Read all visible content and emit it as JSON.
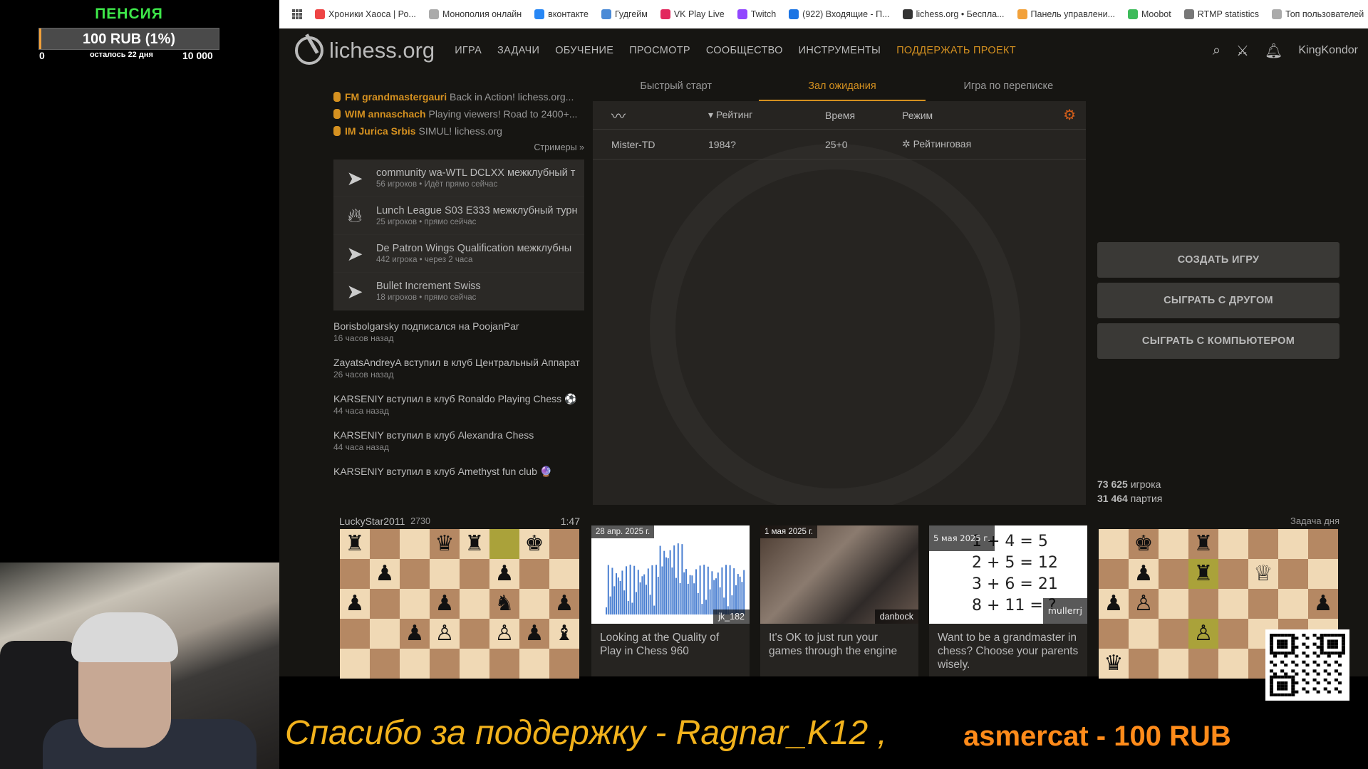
{
  "overlay": {
    "pension_title": "ПЕНСИЯ",
    "goal_text": "100 RUB (1%)",
    "goal_min": "0",
    "goal_remaining": "осталось 22 дня",
    "goal_max": "10 000",
    "goal_progress": 0.01,
    "accent_color": "#3ee84a"
  },
  "bookmarks": [
    {
      "label": "Хроники Хаоса | Ро...",
      "icon": "chaos-icon",
      "color": "#e44"
    },
    {
      "label": "Монополия онлайн",
      "icon": "monopoly-icon",
      "color": "#aaa"
    },
    {
      "label": "вконтакте",
      "icon": "vk-icon",
      "color": "#2787f5"
    },
    {
      "label": "Гудгейм",
      "icon": "goodgame-icon",
      "color": "#4a8ad6"
    },
    {
      "label": "VK Play Live",
      "icon": "vkplay-icon",
      "color": "#e2275d"
    },
    {
      "label": "Twitch",
      "icon": "twitch-icon",
      "color": "#9146ff"
    },
    {
      "label": "(922) Входящие - П...",
      "icon": "mail-icon",
      "color": "#1b74e4"
    },
    {
      "label": "lichess.org • Беспла...",
      "icon": "lichess-icon",
      "color": "#333"
    },
    {
      "label": "Панель управлени...",
      "icon": "panel-icon",
      "color": "#f2a13a"
    },
    {
      "label": "Moobot",
      "icon": "moobot-icon",
      "color": "#3dbb5a"
    },
    {
      "label": "RTMP statistics",
      "icon": "rtmp-icon",
      "color": "#777"
    },
    {
      "label": "Топ пользователей",
      "icon": "top-icon",
      "color": "#aaa"
    }
  ],
  "nav": {
    "logo": "lichess.org",
    "items": [
      "ИГРА",
      "ЗАДАЧИ",
      "ОБУЧЕНИЕ",
      "ПРОСМОТР",
      "СООБЩЕСТВО",
      "ИНСТРУМЕНТЫ"
    ],
    "donate": "ПОДДЕРЖАТЬ ПРОЕКТ",
    "username": "KingKondor"
  },
  "streamers": [
    {
      "title": "FM grandmastergauri",
      "desc": "Back in Action! lichess.org..."
    },
    {
      "title": "WIM annaschach",
      "desc": "Playing viewers! Road to 2400+..."
    },
    {
      "title": "IM Jurica Srbis",
      "desc": "SIMUL! lichess.org"
    }
  ],
  "streamers_link": "Стримеры »",
  "tournaments": [
    {
      "name": "community wa-WTL DCLXX межклубный т",
      "meta": "56 игроков • Идёт прямо сейчас",
      "icon": "bullet-icon"
    },
    {
      "name": "Lunch League S03 E333 межклубный турн",
      "meta": "25 игроков • прямо сейчас",
      "icon": "fire-icon"
    },
    {
      "name": "De Patron Wings Qualification межклубны",
      "meta": "442 игрока • через 2 часа",
      "icon": "bullet-icon"
    },
    {
      "name": "Bullet Increment Swiss",
      "meta": "18 игроков • прямо сейчас",
      "icon": "bullet-icon"
    }
  ],
  "timeline": [
    {
      "text": "Borisbolgarsky подписался на PoojanPar",
      "ago": "16 часов назад"
    },
    {
      "text": "ZayatsAndreyA вступил в клуб Центральный Аппарат",
      "ago": "26 часов назад"
    },
    {
      "text": "KARSENIY вступил в клуб Ronaldo Playing Chess ⚽",
      "ago": "44 часа назад"
    },
    {
      "text": "KARSENIY вступил в клуб Alexandra Chess",
      "ago": "44 часа назад"
    },
    {
      "text": "KARSENIY вступил в клуб Amethyst fun club 🔮",
      "ago": ""
    }
  ],
  "tabs": [
    "Быстрый старт",
    "Зал ожидания",
    "Игра по переписке"
  ],
  "lobby": {
    "headers": {
      "rating": "Рейтинг",
      "time": "Время",
      "mode": "Режим"
    },
    "rows": [
      {
        "player": "Mister-TD",
        "rating": "1984?",
        "time": "25+0",
        "mode": "Рейтинговая"
      }
    ]
  },
  "actions": [
    "СОЗДАТЬ ИГРУ",
    "СЫГРАТЬ С ДРУГОМ",
    "СЫГРАТЬ С КОМПЬЮТЕРОМ"
  ],
  "counts": {
    "players": "73 625",
    "players_label": "игрока",
    "games": "31 464",
    "games_label": "партия"
  },
  "tv": {
    "player": "LuckyStar2011",
    "rating": "2730",
    "clock": "1:47"
  },
  "puzzle_label": "Задача дня",
  "blogs": [
    {
      "date": "28 апр. 2025 г.",
      "author": "jk_182",
      "title": "Looking at the Quality of Play in Chess 960"
    },
    {
      "date": "1 мая 2025 г.",
      "author": "danbock",
      "title": "It's OK to just run your games through the engine"
    },
    {
      "date": "5 мая 2025 г.",
      "author": "mullerrj",
      "title": "Want to be a grandmaster in chess? Choose your parents wisely."
    }
  ],
  "blog_math": [
    "1 + 4 = 5",
    "2 + 5 = 12",
    "3 + 6 = 21",
    "8 + 11 = ?"
  ],
  "ticker": {
    "thanks": "Спасибо за поддержку - Ragnar_K12  ,",
    "donation": "asmercat - 100 RUB"
  }
}
